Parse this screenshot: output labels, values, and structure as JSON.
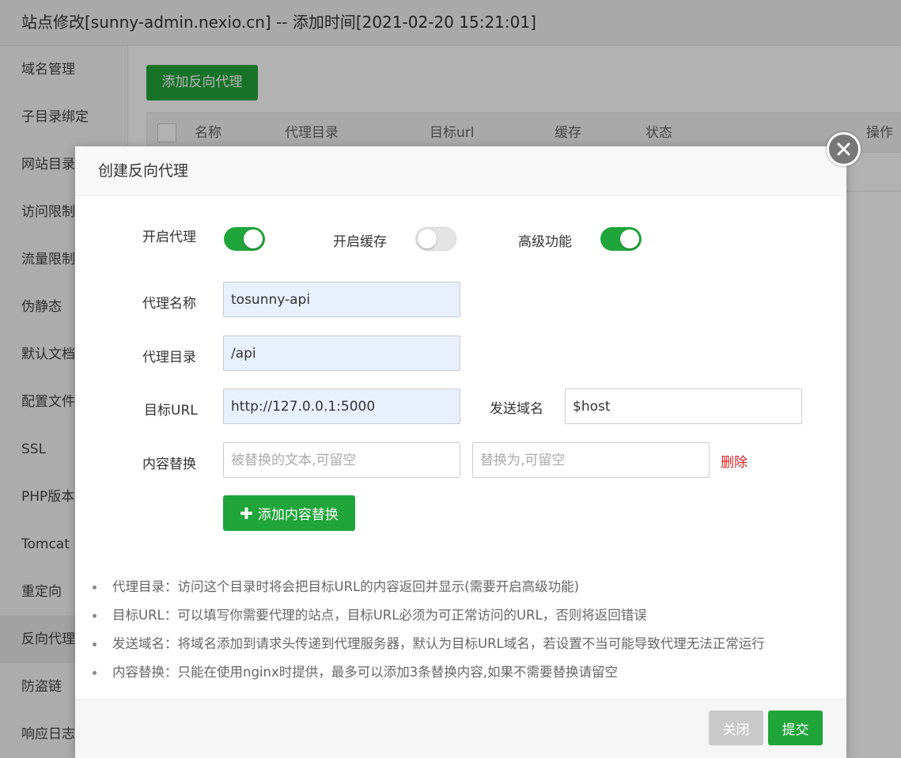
{
  "page": {
    "title": "站点修改[sunny-admin.nexio.cn] -- 添加时间[2021-02-20 15:21:01]"
  },
  "sidebar": {
    "items": [
      {
        "label": "域名管理"
      },
      {
        "label": "子目录绑定"
      },
      {
        "label": "网站目录"
      },
      {
        "label": "访问限制"
      },
      {
        "label": "流量限制"
      },
      {
        "label": "伪静态"
      },
      {
        "label": "默认文档"
      },
      {
        "label": "配置文件"
      },
      {
        "label": "SSL"
      },
      {
        "label": "PHP版本"
      },
      {
        "label": "Tomcat"
      },
      {
        "label": "重定向"
      },
      {
        "label": "反向代理"
      },
      {
        "label": "防盗链"
      },
      {
        "label": "响应日志"
      }
    ],
    "active": "反向代理"
  },
  "main": {
    "add_button": "添加反向代理",
    "table": {
      "columns": [
        "名称",
        "代理目录",
        "目标url",
        "缓存",
        "状态",
        "操作"
      ]
    }
  },
  "dialog": {
    "title": "创建反向代理",
    "toggles": {
      "proxy": {
        "label": "开启代理",
        "on": true
      },
      "cache": {
        "label": "开启缓存",
        "on": false
      },
      "advanced": {
        "label": "高级功能",
        "on": true
      }
    },
    "fields": {
      "proxy_name": {
        "label": "代理名称",
        "value": "tosunny-api"
      },
      "proxy_dir": {
        "label": "代理目录",
        "value": "/api"
      },
      "target_url": {
        "label": "目标URL",
        "value": "http://127.0.0.1:5000"
      },
      "send_domain": {
        "label": "发送域名",
        "value": "$host"
      },
      "content_replace": {
        "label": "内容替换",
        "from_placeholder": "被替换的文本,可留空",
        "to_placeholder": "替换为,可留空",
        "delete_label": "删除"
      }
    },
    "add_replace_button": "添加内容替换",
    "tips": [
      "代理目录：访问这个目录时将会把目标URL的内容返回并显示(需要开启高级功能)",
      "目标URL：可以填写你需要代理的站点，目标URL必须为可正常访问的URL，否则将返回错误",
      "发送域名：将域名添加到请求头传递到代理服务器，默认为目标URL域名，若设置不当可能导致代理无法正常运行",
      "内容替换：只能在使用nginx时提供，最多可以添加3条替换内容,如果不需要替换请留空"
    ],
    "footer": {
      "close_label": "关闭",
      "submit_label": "提交"
    }
  },
  "colors": {
    "accent": "#20a53a",
    "danger": "#e02020",
    "disabled": "#c9c9c9"
  }
}
